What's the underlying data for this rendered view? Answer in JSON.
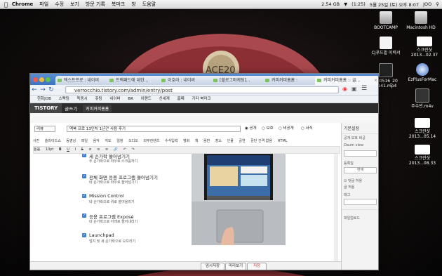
{
  "menubar": {
    "app": "Chrome",
    "items": [
      "파일",
      "수정",
      "보기",
      "방문 기록",
      "북마크",
      "창",
      "도움말"
    ],
    "status": [
      "2.54 GB",
      "(1:25)",
      "5월 25일 (토) 오후 8:07",
      "JOO"
    ]
  },
  "wallpaper": {
    "text": "ACE20"
  },
  "desktop_icons": [
    {
      "label": "BOOTCAMP"
    },
    {
      "label": "Macintosh HD"
    },
    {
      "label": "CJ푸드빌 이력서"
    },
    {
      "label": "스크린샷 2013...02.37"
    },
    {
      "label": "130516_20 1141.mp4"
    },
    {
      "label": "EzPlusForMac"
    },
    {
      "label": "주수빈.m4v"
    },
    {
      "label": "스크린샷 2013...05.14"
    },
    {
      "label": "스크린샷 2013...08.33"
    }
  ],
  "browser": {
    "tabs": [
      {
        "label": "텍스트프로 : 네이버"
      },
      {
        "label": "트랙패드에 대한..."
      },
      {
        "label": "이호라 : 네이버"
      },
      {
        "label": "[블로그마케팅]..."
      },
      {
        "label": "커피커피홈홈 :"
      },
      {
        "label": "커피커피홈홈 :: 글..."
      }
    ],
    "url": "verrocchio.tistory.com/admin/entry/post",
    "bookmarks": [
      "한화JOB",
      "스펙팅",
      "독동시",
      "쥬팅",
      "네이버",
      "BR",
      "이랜드",
      "신세계",
      "홈페",
      "기타 북마크"
    ],
    "tistory": {
      "logo": "TISTORY",
      "write": "글쓰기",
      "blog_name": "커피커피홈홈"
    },
    "category": "리뷰",
    "post_title": "맥북 프로 13인치 1년간 사용 후기",
    "visibility": [
      "공개",
      "보호",
      "비공개",
      "서식"
    ],
    "toolbar1": [
      "사진",
      "슬라이드쇼",
      "동영상",
      "파일",
      "음악",
      "지도",
      "일정",
      "오디오",
      "외부컨텐츠",
      "수식입력",
      "영화",
      "책",
      "음반",
      "장소",
      "인물",
      "공연",
      "문단 간격 없음",
      "HTML"
    ],
    "toolbar2": [
      "돋움",
      "10pt"
    ],
    "list_items": [
      {
        "title": "세 손가락 쓸어넘기기",
        "desc": "두 손가락으로 좌우로 스크롤하기"
      },
      {
        "title": "전체 화면 응용 프로그램 쓸어넘기기",
        "desc": "네 손가락으로 좌우로 쓸어넘기기"
      },
      {
        "title": "Mission Control",
        "desc": "네 손가락으로 위로 쓸어올리기"
      },
      {
        "title": "응용 프로그램 Exposé",
        "desc": "네 손가락으로 아래로 쓸어내리기"
      },
      {
        "title": "Launchpad",
        "desc": "엄지 및 세 손가락으로 오므리기"
      }
    ],
    "side": {
      "title": "기본설정",
      "items": [
        "공개",
        "보호",
        "비공",
        "Daum view",
        "등록일",
        "현재",
        "댓글 허용",
        "글 허용",
        "태그",
        "파일업로드"
      ]
    },
    "bottom_buttons": [
      "임시저장",
      "미리보기",
      "저장"
    ]
  },
  "colors": {
    "accent": "#3d7ed6",
    "tistory_bg": "#2b2b2b"
  }
}
